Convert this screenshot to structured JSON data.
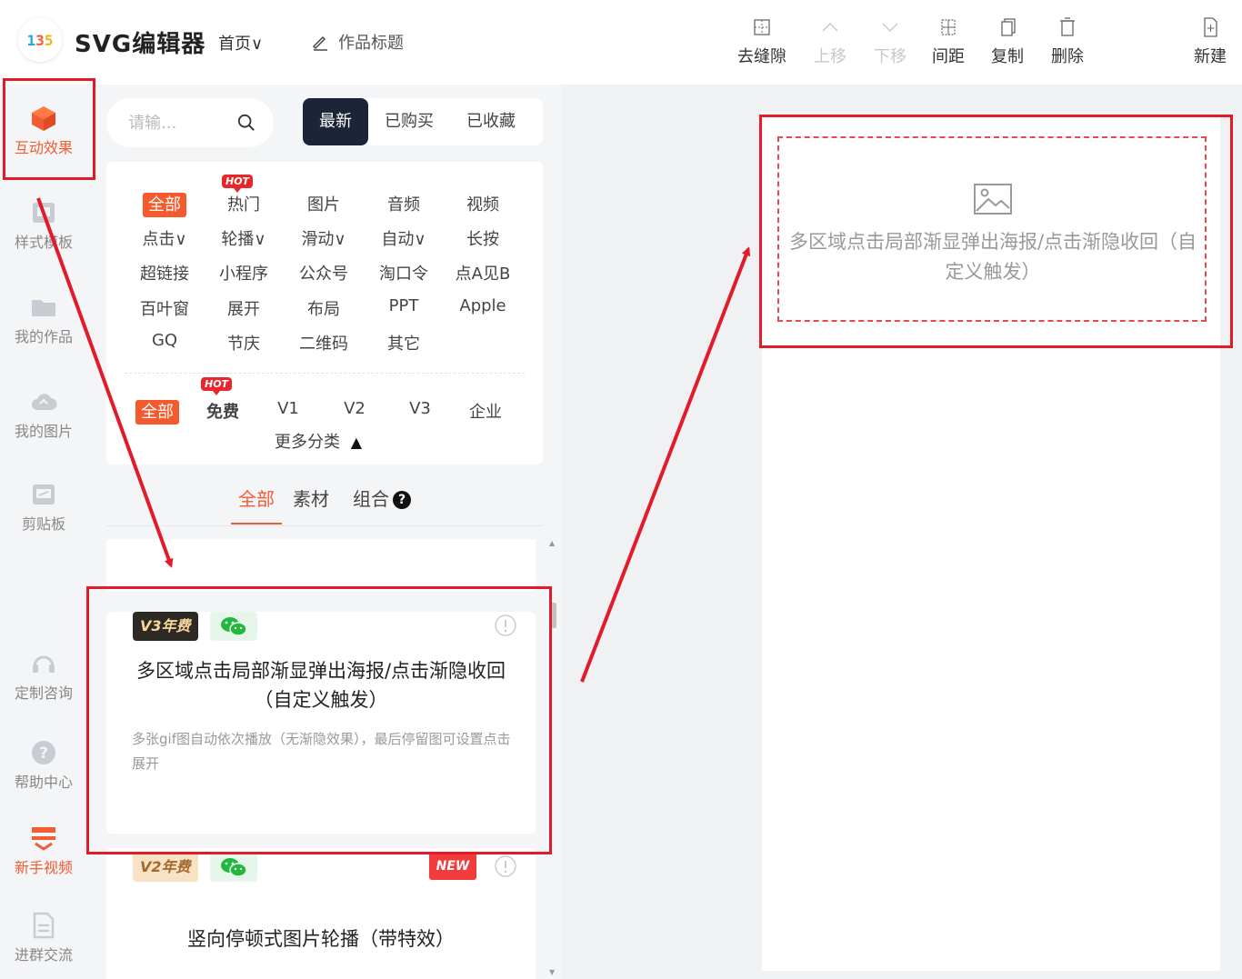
{
  "header": {
    "logo_text": "135",
    "brand": "SVG编辑器",
    "home_menu": "首页",
    "work_title": "作品标题",
    "tools": [
      {
        "id": "gap",
        "label": "去缝隙",
        "icon": "grid-dots-icon",
        "enabled": true
      },
      {
        "id": "up",
        "label": "上移",
        "icon": "chevron-up-icon",
        "enabled": false
      },
      {
        "id": "down",
        "label": "下移",
        "icon": "chevron-down-icon",
        "enabled": false
      },
      {
        "id": "spacing",
        "label": "间距",
        "icon": "spacing-icon",
        "enabled": true
      },
      {
        "id": "copy",
        "label": "复制",
        "icon": "copy-icon",
        "enabled": true
      },
      {
        "id": "delete",
        "label": "删除",
        "icon": "trash-icon",
        "enabled": true
      },
      {
        "id": "new",
        "label": "新建",
        "icon": "new-file-icon",
        "enabled": true
      }
    ]
  },
  "sidebar": {
    "items": [
      {
        "label": "互动效果",
        "icon": "cube-icon",
        "active": true
      },
      {
        "label": "样式模板",
        "icon": "template-icon",
        "active": false
      },
      {
        "label": "我的作品",
        "icon": "folder-icon",
        "active": false
      },
      {
        "label": "我的图片",
        "icon": "cloud-icon",
        "active": false
      },
      {
        "label": "剪贴板",
        "icon": "clipboard-icon",
        "active": false
      },
      {
        "label": "定制咨询",
        "icon": "headset-icon",
        "active": false
      },
      {
        "label": "帮助中心",
        "icon": "help-icon",
        "active": false
      },
      {
        "label": "新手视频",
        "icon": "video-icon",
        "active": false
      },
      {
        "label": "进群交流",
        "icon": "document-icon",
        "active": false
      }
    ]
  },
  "panel": {
    "search_placeholder": "请输...",
    "tabs": [
      {
        "label": "最新",
        "active": true
      },
      {
        "label": "已购买",
        "active": false
      },
      {
        "label": "已收藏",
        "active": false
      }
    ],
    "categories": [
      "全部",
      "热门",
      "图片",
      "音频",
      "视频",
      "点击∨",
      "轮播∨",
      "滑动∨",
      "自动∨",
      "长按",
      "超链接",
      "小程序",
      "公众号",
      "淘口令",
      "点A见B",
      "百叶窗",
      "展开",
      "布局",
      "PPT",
      "Apple",
      "GQ",
      "节庆",
      "二维码",
      "其它"
    ],
    "hot_label": "HOT",
    "versions": [
      "全部",
      "免费",
      "V1",
      "V2",
      "V3",
      "企业"
    ],
    "more_categories": "更多分类",
    "sub_tabs": [
      {
        "label": "全部",
        "active": true
      },
      {
        "label": "素材",
        "active": false
      },
      {
        "label": "组合",
        "active": false
      }
    ],
    "help_mark": "?",
    "items": [
      {
        "version_badge": "V3年费",
        "title": "多区域点击局部渐显弹出海报/点击渐隐收回（自定义触发）",
        "desc": "多张gif图自动依次播放（无渐隐效果），最后停留图可设置点击展开"
      },
      {
        "version_badge": "V2年费",
        "new_badge": "NEW",
        "title": "竖向停顿式图片轮播（带特效）"
      }
    ]
  },
  "canvas": {
    "placeholder_text": "多区域点击局部渐显弹出海报/点击渐隐收回（自定义触发）"
  },
  "colors": {
    "accent": "#f35b33",
    "dark_tab": "#1c2438",
    "annotation": "#e21b2a",
    "hot": "#e8272d"
  }
}
